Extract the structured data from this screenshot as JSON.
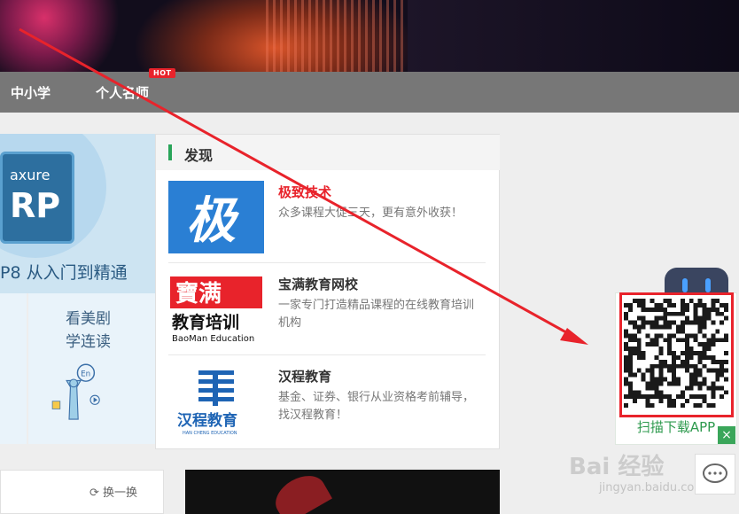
{
  "nav": {
    "items": [
      "中小学",
      "个人名师"
    ],
    "hot_badge": "HOT"
  },
  "promo": {
    "card_small": "axure",
    "card_big": "RP",
    "caption": "P8 从入门到精通",
    "drama_line1": "看美剧",
    "drama_line2": "学连读",
    "bubble": "En"
  },
  "discover": {
    "title": "发现",
    "items": [
      {
        "name": "极致技术",
        "desc": "众多课程大促三天，更有意外收获！",
        "logo_char": "极"
      },
      {
        "name": "宝满教育网校",
        "desc": "一家专门打造精品课程的在线教育培训机构",
        "logo_cn": "寶满",
        "logo_sub": "教育培训",
        "logo_en": "BaoMan Education"
      },
      {
        "name": "汉程教育",
        "desc": "基金、证券、银行从业资格考前辅导，找汉程教育！",
        "logo_cn": "汉程教育",
        "logo_en": "HAN CHENG EDUCATION"
      }
    ]
  },
  "bottom": {
    "refresh_label": "换一换"
  },
  "qr": {
    "caption": "扫描下载APP",
    "close": "×"
  },
  "watermark": {
    "main": "Bai 经验",
    "sub": "jingyan.baidu.com"
  },
  "colors": {
    "nav_bg": "#777777",
    "accent_green": "#2aa55a",
    "accent_red": "#e8232b",
    "annotation_red": "#e8232b"
  }
}
